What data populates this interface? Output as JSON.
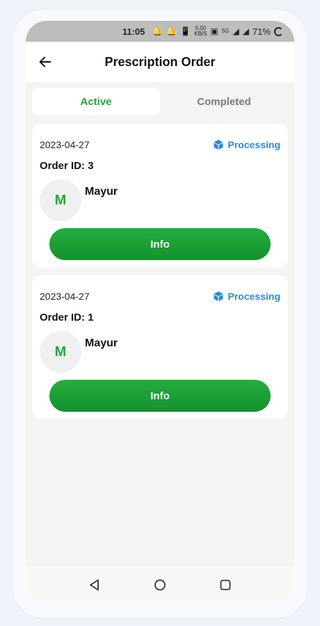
{
  "status_bar": {
    "time": "11:05",
    "speed_value": "5.00",
    "speed_unit": "KB/S",
    "network": "5G",
    "battery": "71%"
  },
  "app_bar": {
    "title": "Prescription Order",
    "back_icon": "arrow-left-icon"
  },
  "tabs": [
    {
      "label": "Active",
      "selected": true
    },
    {
      "label": "Completed",
      "selected": false
    }
  ],
  "orders": [
    {
      "date": "2023-04-27",
      "status": "Processing",
      "order_id": "Order ID: 3",
      "avatar_letter": "M",
      "name": "Mayur",
      "button": "Info"
    },
    {
      "date": "2023-04-27",
      "status": "Processing",
      "order_id": "Order ID: 1",
      "avatar_letter": "M",
      "name": "Mayur",
      "button": "Info"
    }
  ],
  "colors": {
    "accent_green": "#21a63a",
    "status_blue": "#2b8ad8",
    "background": "#f4f4f4"
  },
  "nav": [
    "back-triangle-icon",
    "home-circle-icon",
    "recents-square-icon"
  ]
}
